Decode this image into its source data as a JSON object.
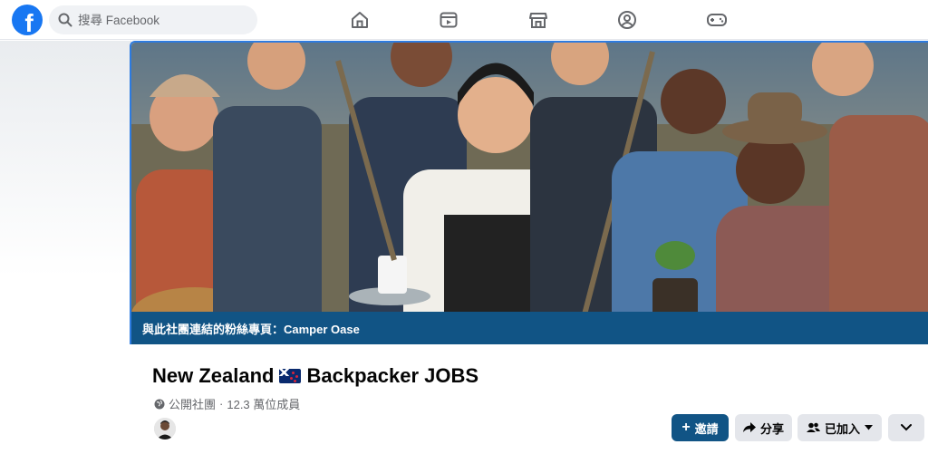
{
  "header": {
    "logo_letter": "f",
    "search_placeholder": "搜尋 Facebook",
    "nav_icons": [
      "home-icon",
      "video-icon",
      "marketplace-icon",
      "groups-icon",
      "gaming-icon"
    ]
  },
  "cover": {
    "linked_page_text": "與此社團連結的粉絲專頁：Camper Oase"
  },
  "group": {
    "name_part1": "New Zealand",
    "name_part2": "Backpacker JOBS",
    "privacy": "公開社團",
    "separator": "·",
    "members": "12.3 萬位成員"
  },
  "actions": {
    "invite_label": "邀請",
    "share_label": "分享",
    "joined_label": "已加入"
  },
  "colors": {
    "brand": "#1877f2",
    "accent": "#115485"
  }
}
